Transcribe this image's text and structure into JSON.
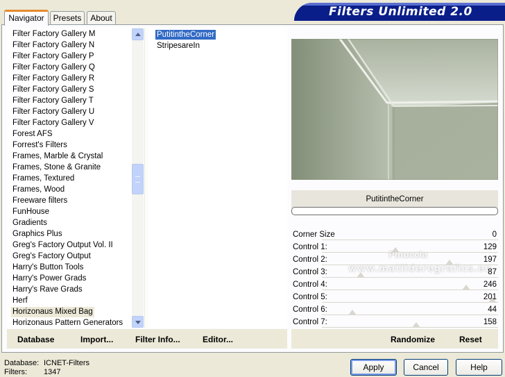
{
  "app": {
    "banner_title": "Filters Unlimited 2.0"
  },
  "tabs": [
    {
      "label": "Navigator"
    },
    {
      "label": "Presets"
    },
    {
      "label": "About"
    }
  ],
  "categories": [
    "Filter Factory Gallery M",
    "Filter Factory Gallery N",
    "Filter Factory Gallery P",
    "Filter Factory Gallery Q",
    "Filter Factory Gallery R",
    "Filter Factory Gallery S",
    "Filter Factory Gallery T",
    "Filter Factory Gallery U",
    "Filter Factory Gallery V",
    "Forest AFS",
    "Forrest's Filters",
    "Frames, Marble & Crystal",
    "Frames, Stone & Granite",
    "Frames, Textured",
    "Frames, Wood",
    "Freeware filters",
    "FunHouse",
    "Gradients",
    "Graphics Plus",
    "Greg's Factory Output Vol. II",
    "Greg's Factory Output",
    "Harry's Button Tools",
    "Harry's Power Grads",
    "Harry's Rave Grads",
    "Herf",
    "Horizonaus Mixed Bag",
    "Horizonaus Pattern Generators"
  ],
  "selected_category": "Horizonaus Mixed Bag",
  "filters": [
    "PutitintheCorner",
    "StripesareIn"
  ],
  "selected_filter": "PutitintheCorner",
  "left_bar": {
    "database": "Database",
    "import": "Import...",
    "filter_info": "Filter Info...",
    "editor": "Editor..."
  },
  "right_bar": {
    "randomize": "Randomize",
    "reset": "Reset"
  },
  "filter_name": "PutitintheCorner",
  "controls": [
    {
      "label": "Corner Size",
      "value": "0"
    },
    {
      "label": "Control 1:",
      "value": "129"
    },
    {
      "label": "Control 2:",
      "value": "197"
    },
    {
      "label": "Control 3:",
      "value": "87"
    },
    {
      "label": "Control 4:",
      "value": "246"
    },
    {
      "label": "Control 5:",
      "value": "201"
    },
    {
      "label": "Control 6:",
      "value": "44"
    },
    {
      "label": "Control 7:",
      "value": "158"
    }
  ],
  "watermark": {
    "line1": "Pinuccia",
    "line2": "www.matilderegrafics.eu"
  },
  "status": {
    "database_label": "Database:",
    "database_value": "ICNET-Filters",
    "filters_label": "Filters:",
    "filters_value": "1347"
  },
  "buttons": {
    "apply": "Apply",
    "cancel": "Cancel",
    "help": "Help"
  },
  "colors": {
    "accent_tab": "#e68b2c",
    "selection": "#316ac5",
    "banner": "#0a1e8a",
    "preview_base": "#a4ae9a"
  }
}
